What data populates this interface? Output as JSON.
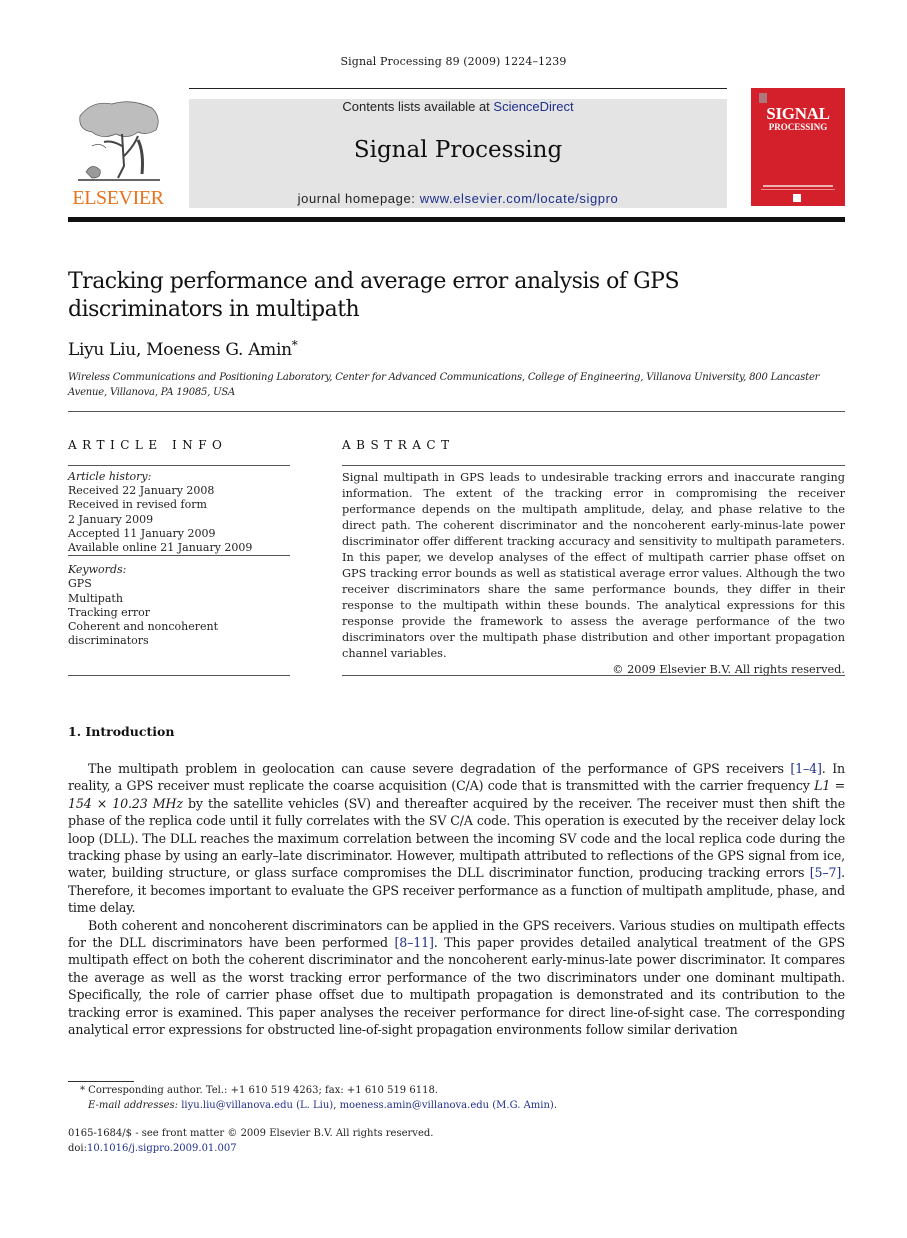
{
  "header": {
    "running_head": "Signal Processing 89 (2009) 1224–1239",
    "contents_prefix": "Contents lists available at ",
    "contents_link": "ScienceDirect",
    "journal_name": "Signal Processing",
    "homepage_prefix": "journal homepage: ",
    "homepage_link": "www.elsevier.com/locate/sigpro",
    "publisher_logo_text": "ELSEVIER",
    "cover_title": "SIGNAL",
    "cover_subtitle": "PROCESSING"
  },
  "article": {
    "title": "Tracking performance and average error analysis of GPS discriminators in multipath",
    "authors": "Liyu Liu, Moeness G. Amin",
    "author_mark": "*",
    "affiliation": "Wireless Communications and Positioning Laboratory, Center for Advanced Communications, College of Engineering, Villanova University, 800 Lancaster Avenue, Villanova, PA 19085, USA"
  },
  "article_info": {
    "heading": "ARTICLE INFO",
    "history_label": "Article history:",
    "history": [
      "Received 22 January 2008",
      "Received in revised form",
      "2 January 2009",
      "Accepted 11 January 2009",
      "Available online 21 January 2009"
    ],
    "keywords_label": "Keywords:",
    "keywords": [
      "GPS",
      "Multipath",
      "Tracking error",
      "Coherent and noncoherent discriminators"
    ]
  },
  "abstract": {
    "heading": "ABSTRACT",
    "text": "Signal multipath in GPS leads to undesirable tracking errors and inaccurate ranging information. The extent of the tracking error in compromising the receiver performance depends on the multipath amplitude, delay, and phase relative to the direct path. The coherent discriminator and the noncoherent early-minus-late power discriminator offer different tracking accuracy and sensitivity to multipath parameters. In this paper, we develop analyses of the effect of multipath carrier phase offset on GPS tracking error bounds as well as statistical average error values. Although the two receiver discriminators share the same performance bounds, they differ in their response to the multipath within these bounds. The analytical expressions for this response provide the framework to assess the average performance of the two discriminators over the multipath phase distribution and other important propagation channel variables.",
    "copyright": "© 2009 Elsevier B.V. All rights reserved."
  },
  "introduction": {
    "heading": "1.  Introduction",
    "p1_a": "The multipath problem in geolocation can cause severe degradation of the performance of GPS receivers ",
    "p1_ref1": "[1–4]",
    "p1_b": ". In reality, a GPS receiver must replicate the coarse acquisition (C/A) code that is transmitted with the carrier frequency ",
    "p1_eq": "L1 = 154 × 10.23 MHz",
    "p1_c": " by the satellite vehicles (SV) and thereafter acquired by the receiver. The receiver must then shift the phase of the replica code until it fully correlates with the SV C/A code. This operation is executed by the receiver delay lock loop (DLL). The DLL reaches the maximum correlation between the incoming SV code and the local replica code during the tracking phase by using an early–late discriminator. However, multipath attributed to reflections of the GPS signal from ice, water, building structure, or glass surface compromises the DLL discriminator function, producing tracking errors ",
    "p1_ref2": "[5–7]",
    "p1_d": ". Therefore, it becomes important to evaluate the GPS receiver performance as a function of multipath amplitude, phase, and time delay.",
    "p2_a": "Both coherent and noncoherent discriminators can be applied in the GPS receivers. Various studies on multipath effects for the DLL discriminators have been performed ",
    "p2_ref": "[8–11]",
    "p2_b": ". This paper provides detailed analytical treatment of the GPS multipath effect on both the coherent discriminator and the noncoherent early-minus-late power discriminator. It compares the average as well as the worst tracking error performance of the two discriminators under one dominant multipath. Specifically, the role of carrier phase offset due to multipath propagation is demonstrated and its contribution to the tracking error is examined. This paper analyses the receiver performance for direct line-of-sight case. The corresponding analytical error expressions for obstructed line-of-sight propagation environments follow similar derivation"
  },
  "footnotes": {
    "corresponding": "* Corresponding author. Tel.: +1 610 519 4263; fax: +1 610 519 6118.",
    "email_label": "E-mail addresses: ",
    "email1": "liyu.liu@villanova.edu (L. Liu)",
    "sep": ", ",
    "email2": "moeness.amin@villanova.edu (M.G. Amin)",
    "end": ".",
    "front_matter": "0165-1684/$ - see front matter © 2009 Elsevier B.V. All rights reserved.",
    "doi_label": "doi:",
    "doi": "10.1016/j.sigpro.2009.01.007"
  },
  "colors": {
    "link": "#1f2f8a",
    "elsevier_orange": "#e8731c",
    "cover_red": "#d4202a",
    "masthead_gray": "#e4e4e4"
  }
}
